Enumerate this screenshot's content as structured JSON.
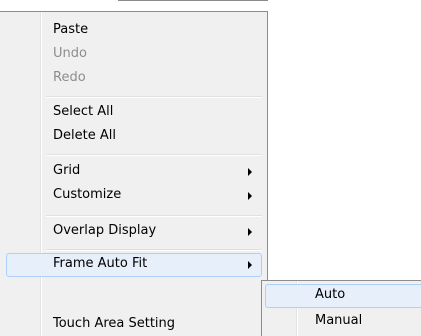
{
  "context_menu": {
    "items": [
      {
        "label": "Paste",
        "disabled": false,
        "submenu": false
      },
      {
        "label": "Undo",
        "disabled": true,
        "submenu": false
      },
      {
        "label": "Redo",
        "disabled": true,
        "submenu": false
      },
      {
        "label": "Select All",
        "disabled": false,
        "submenu": false
      },
      {
        "label": "Delete All",
        "disabled": false,
        "submenu": false
      },
      {
        "label": "Grid",
        "disabled": false,
        "submenu": true
      },
      {
        "label": "Customize",
        "disabled": false,
        "submenu": true
      },
      {
        "label": "Overlap Display",
        "disabled": false,
        "submenu": true
      },
      {
        "label": "Frame Auto Fit",
        "disabled": false,
        "submenu": true,
        "highlighted": true
      },
      {
        "label": "Touch Area Setting",
        "disabled": false,
        "submenu": false
      }
    ]
  },
  "submenu": {
    "parent": "Frame Auto Fit",
    "items": [
      {
        "label": "Auto",
        "highlighted": true
      },
      {
        "label": "Manual",
        "highlighted": false
      }
    ]
  },
  "colors": {
    "menu_bg": "#f0f0f0",
    "highlight_bg": "#e7effa",
    "highlight_border": "#aecff7",
    "disabled_text": "#8d8d8d",
    "border": "#8c8c8c"
  }
}
